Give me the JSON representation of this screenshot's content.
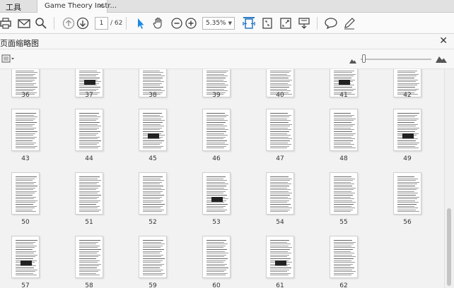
{
  "tabs": {
    "tools_label": "工具",
    "document_tab": "Game Theory Instr...",
    "close_glyph": "×"
  },
  "toolbar": {
    "current_page": "1",
    "total_pages": "/ 62",
    "zoom": "5.35%",
    "icons": [
      "print-icon",
      "email-icon",
      "search-icon",
      "page-up-icon",
      "page-down-icon",
      "select-arrow-icon",
      "hand-icon",
      "zoom-out-icon",
      "zoom-in-icon",
      "fit-width-icon",
      "fit-page-icon",
      "full-screen-icon",
      "read-mode-icon",
      "comment-icon",
      "sign-icon"
    ]
  },
  "panel": {
    "title": "页面缩略图",
    "close_glyph": "✕",
    "options_icon": "thumbnail-options-icon",
    "thumbnail_size_level": 0.05
  },
  "thumbnails": {
    "row1": [
      "36",
      "37",
      "38",
      "39",
      "40",
      "41",
      "42"
    ],
    "row2": [
      "43",
      "44",
      "45",
      "46",
      "47",
      "48",
      "49"
    ],
    "row3": [
      "50",
      "51",
      "52",
      "53",
      "54",
      "55",
      "56"
    ],
    "row4": [
      "57",
      "58",
      "59",
      "60",
      "61",
      "62"
    ]
  },
  "colors": {
    "accent": "#1c6fbf",
    "select_tool": "#1e88e5"
  }
}
